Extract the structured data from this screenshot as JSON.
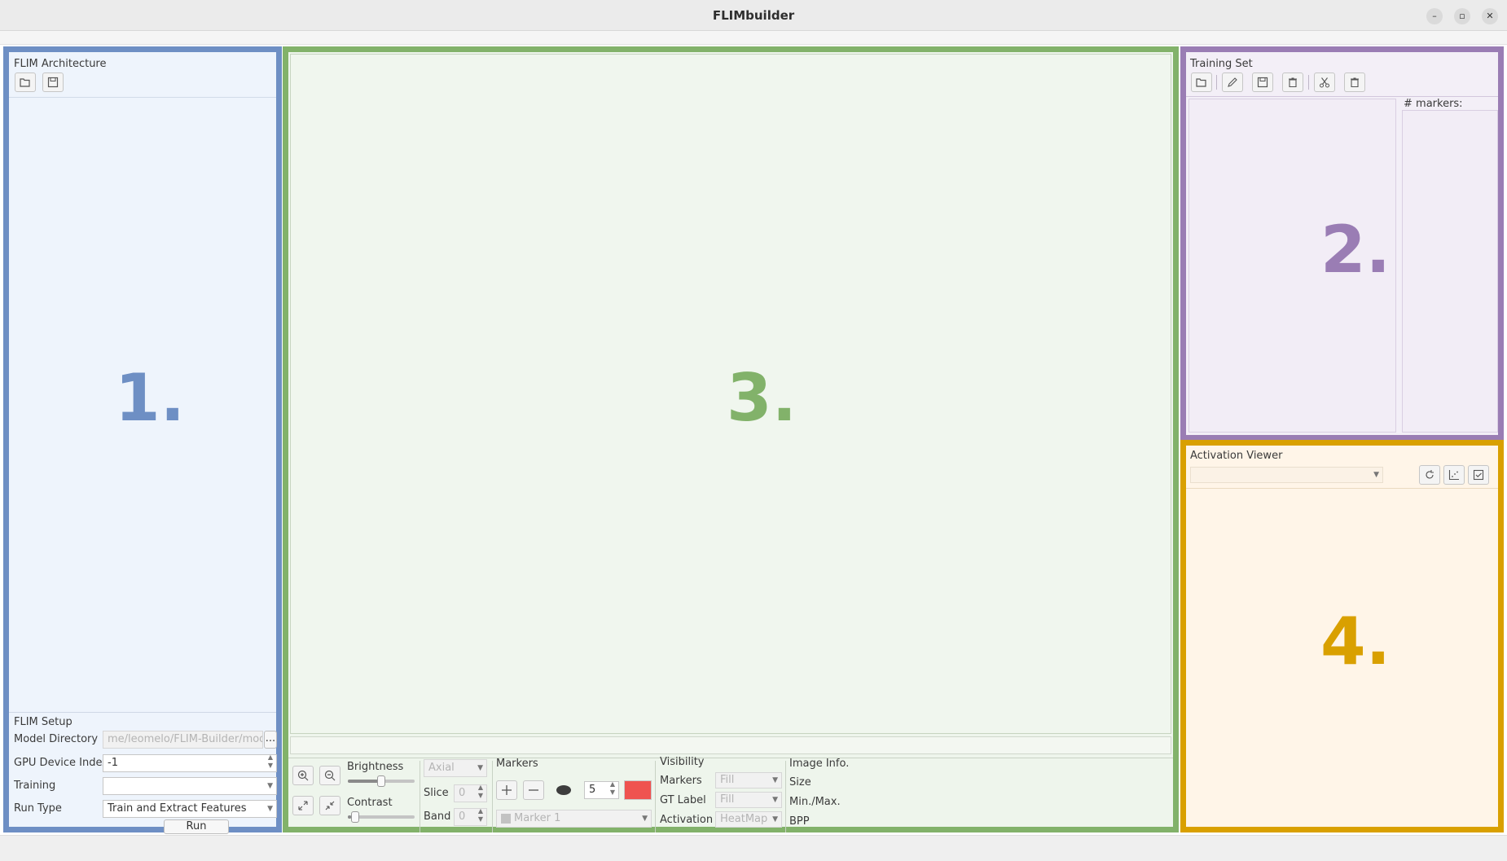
{
  "window": {
    "title": "FLIMbuilder"
  },
  "panel1": {
    "number": "1.",
    "color": "#6e8fc4",
    "title": "FLIM Architecture",
    "setup": {
      "title": "FLIM Setup",
      "model_directory_label": "Model Directory",
      "model_directory_value": "me/leomelo/FLIM-Builder/model/",
      "browse_label": "...",
      "gpu_label": "GPU Device Index",
      "gpu_value": "-1",
      "training_label": "Training",
      "training_value": "",
      "run_type_label": "Run Type",
      "run_type_value": "Train and Extract Features",
      "run_button": "Run"
    }
  },
  "panel2": {
    "number": "2.",
    "color": "#9a7db4",
    "title": "Training Set",
    "markers_label": "# markers:"
  },
  "panel3": {
    "number": "3.",
    "color": "#82b26a",
    "brightness_label": "Brightness",
    "brightness_level": 0.5,
    "contrast_label": "Contrast",
    "contrast_level": 0.05,
    "view_value": "Axial",
    "slice_label": "Slice",
    "slice_value": "0",
    "band_label": "Band",
    "band_value": "0",
    "markers_title": "Markers",
    "marker_size": "5",
    "marker_color": "#ef5350",
    "marker_name": "Marker 1",
    "visibility_title": "Visibility",
    "vis_markers_label": "Markers",
    "vis_markers_value": "Fill",
    "vis_gt_label": "GT Label",
    "vis_gt_value": "Fill",
    "vis_activation_label": "Activation",
    "vis_activation_value": "HeatMap",
    "image_info_title": "Image Info.",
    "info_size_label": "Size",
    "info_minmax_label": "Min./Max.",
    "info_bpp_label": "BPP"
  },
  "panel4": {
    "number": "4.",
    "color": "#d9a000",
    "title": "Activation Viewer",
    "layer_value": ""
  }
}
